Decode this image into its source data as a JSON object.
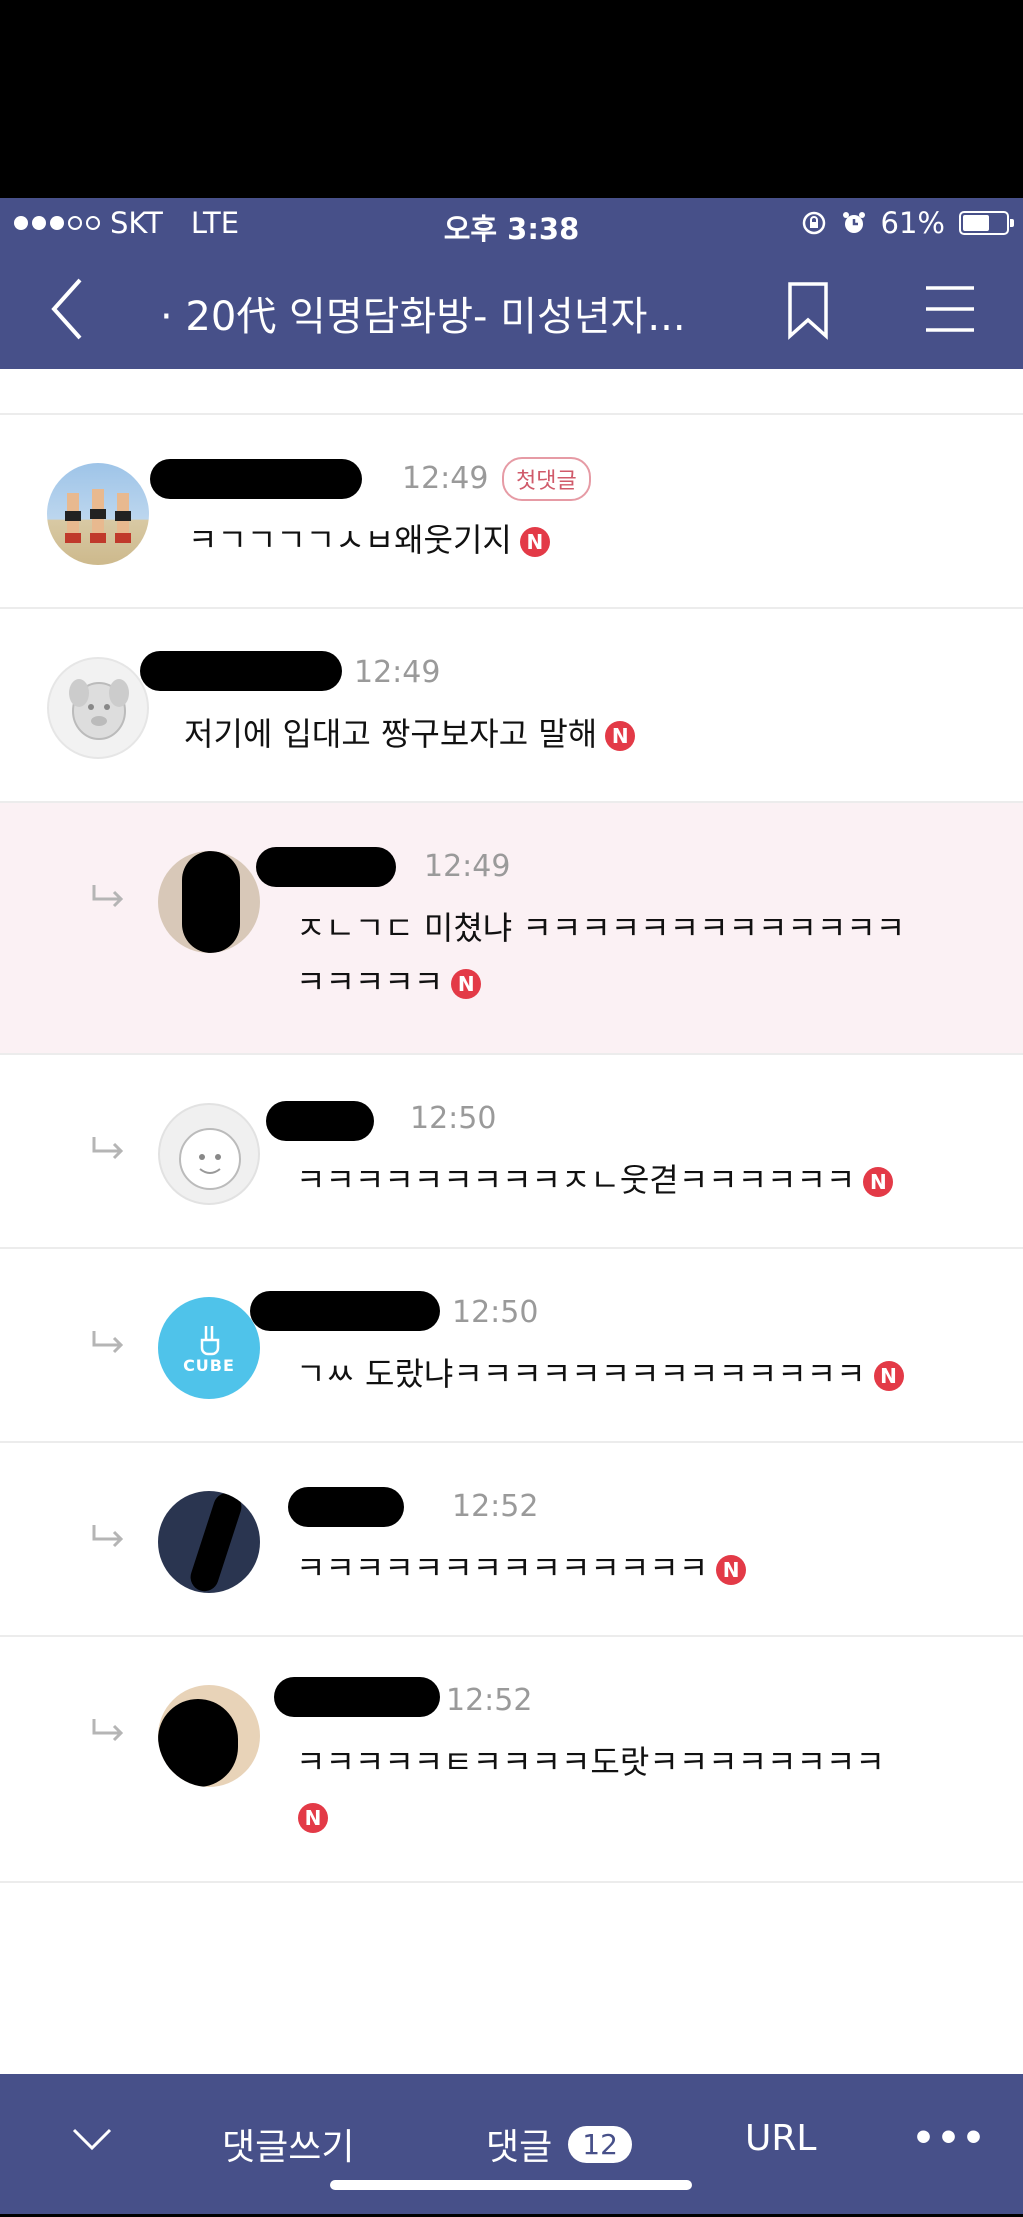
{
  "status_bar": {
    "carrier": "SKT",
    "network": "LTE",
    "time": "오후 3:38",
    "battery": "61%",
    "battery_level": 0.61
  },
  "header": {
    "title": "· 20代 익명담화방- 미성년자..."
  },
  "comments": [
    {
      "time": "12:49",
      "badge": "첫댓글",
      "text": "ㅋㄱㄱㄱㄱㅅㅂ왜웃기지",
      "new": "N"
    },
    {
      "time": "12:49",
      "text": "저기에 입대고 짱구보자고 말해",
      "new": "N"
    },
    {
      "time": "12:49",
      "text_line1": "ㅈㄴㄱㄷ 미쳤냐 ㅋㅋㅋㅋㅋㅋㅋㅋㅋㅋㅋㅋㅋ",
      "text_line2": "ㅋㅋㅋㅋㅋ",
      "new": "N"
    },
    {
      "time": "12:50",
      "text": "ㅋㅋㅋㅋㅋㅋㅋㅋㅋㅈㄴ웃겯ㅋㅋㅋㅋㅋㅋ",
      "new": "N"
    },
    {
      "time": "12:50",
      "avatar_label": "CUBE",
      "text": "ㄱㅆ 도랐냐ㅋㅋㅋㅋㅋㅋㅋㅋㅋㅋㅋㅋㅋㅋ",
      "new": "N"
    },
    {
      "time": "12:52",
      "text": "ㅋㅋㅋㅋㅋㅋㅋㅋㅋㅋㅋㅋㅋㅋ",
      "new": "N"
    },
    {
      "time": "12:52",
      "text": "ㅋㅋㅋㅋㅋㅌㅋㅋㅋㅋ도랏ㅋㅋㅋㅋㅋㅋㅋㅋ",
      "new": "N"
    }
  ],
  "bottom_bar": {
    "write_label": "댓글쓰기",
    "comments_label": "댓글",
    "comments_count": "12",
    "url_label": "URL",
    "more_label": "•••"
  },
  "colors": {
    "brand": "#475089",
    "highlight_row": "#fbf1f4",
    "new_badge": "#e33a47"
  }
}
